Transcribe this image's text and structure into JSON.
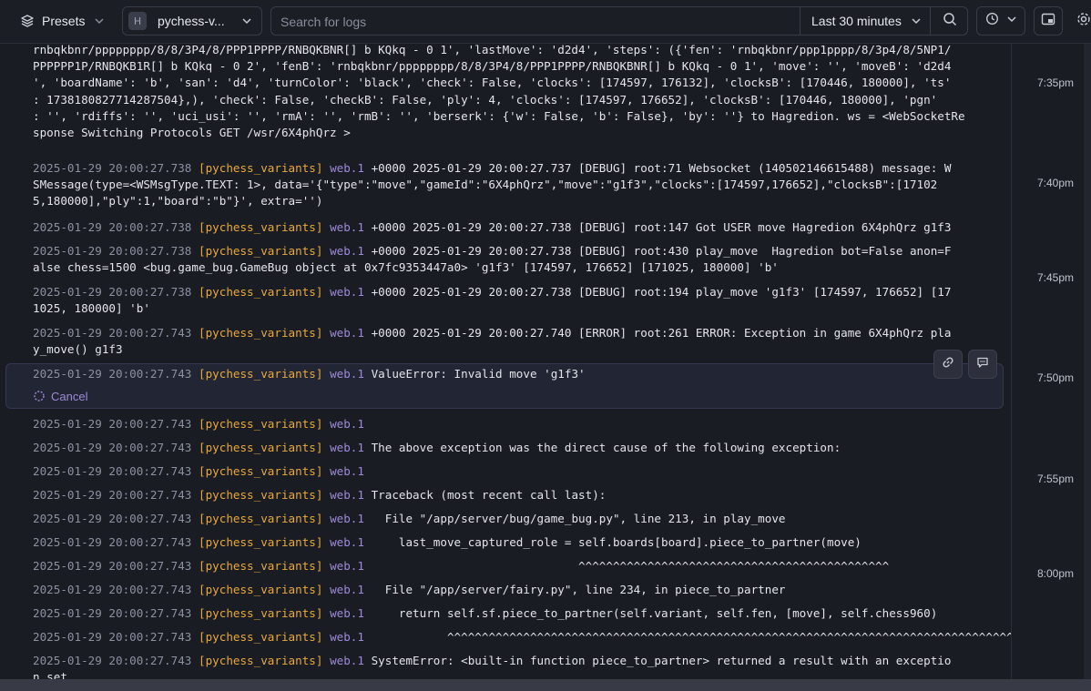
{
  "toolbar": {
    "presets_label": "Presets",
    "source_label": "pychess-v...",
    "search_placeholder": "Search for logs",
    "time_range_label": "Last 30 minutes"
  },
  "timeline": {
    "ticks": [
      "7:35pm",
      "7:40pm",
      "7:45pm",
      "7:50pm",
      "7:55pm",
      "8:00pm"
    ]
  },
  "highlight": {
    "cancel_label": "Cancel"
  },
  "log": {
    "top_lines": [
      "rnbqkbnr/pppppppp/8/8/3P4/8/PPP1PPPP/RNBQKBNR[] b KQkq - 0 1', 'lastMove': 'd2d4', 'steps': ({'fen': 'rnbqkbnr/ppp1pppp/8/3p4/8/5NP1/",
      "PPPPPP1P/RNBQKB1R[] b KQkq - 0 2', 'fenB': 'rnbqkbnr/pppppppp/8/8/3P4/8/PPP1PPPP/RNBQKBNR[] b KQkq - 0 1', 'move': '', 'moveB': 'd2d4",
      "', 'boardName': 'b', 'san': 'd4', 'turnColor': 'black', 'check': False, 'clocks': [174597, 176132], 'clocksB': [170446, 180000], 'ts'",
      ": 1738180827714287504},), 'check': False, 'checkB': False, 'ply': 4, 'clocks': [174597, 176652], 'clocksB': [170446, 180000], 'pgn'",
      ": '', 'rdiffs': '', 'uci_usi': '', 'rmA': '', 'rmB': '', 'berserk': {'w': False, 'b': False}, 'by': ''} to Hagredion. ws = <WebSocketRe",
      "sponse Switching Protocols GET /wsr/6X4phQrz >"
    ],
    "entries": [
      {
        "ts": "2025-01-29 20:00:27.738",
        "service": "[pychess_variants]",
        "pod": "web.1",
        "lines": [
          " +0000 2025-01-29 20:00:27.737 [DEBUG] root:71 Websocket (140502146615488) message: W",
          "SMessage(type=<WSMsgType.TEXT: 1>, data='{\"type\":\"move\",\"gameId\":\"6X4phQrz\",\"move\":\"g1f3\",\"clocks\":[174597,176652],\"clocksB\":[17102",
          "5,180000],\"ply\":1,\"board\":\"b\"}', extra='')"
        ]
      },
      {
        "ts": "2025-01-29 20:00:27.738",
        "service": "[pychess_variants]",
        "pod": "web.1",
        "lines": [
          " +0000 2025-01-29 20:00:27.738 [DEBUG] root:147 Got USER move Hagredion 6X4phQrz g1f3"
        ]
      },
      {
        "ts": "2025-01-29 20:00:27.738",
        "service": "[pychess_variants]",
        "pod": "web.1",
        "lines": [
          " +0000 2025-01-29 20:00:27.738 [DEBUG] root:430 play_move  Hagredion bot=False anon=F",
          "alse chess=1500 <bug.game_bug.GameBug object at 0x7fc9353447a0> 'g1f3' [174597, 176652] [171025, 180000] 'b'"
        ]
      },
      {
        "ts": "2025-01-29 20:00:27.738",
        "service": "[pychess_variants]",
        "pod": "web.1",
        "lines": [
          " +0000 2025-01-29 20:00:27.738 [DEBUG] root:194 play_move 'g1f3' [174597, 176652] [17",
          "1025, 180000] 'b'"
        ]
      },
      {
        "ts": "2025-01-29 20:00:27.743",
        "service": "[pychess_variants]",
        "pod": "web.1",
        "lines": [
          " +0000 2025-01-29 20:00:27.740 [ERROR] root:261 ERROR: Exception in game 6X4phQrz pla",
          "y_move() g1f3"
        ]
      },
      {
        "ts": "2025-01-29 20:00:27.743",
        "service": "[pychess_variants]",
        "pod": "web.1",
        "lines": [
          " ValueError: Invalid move 'g1f3'"
        ]
      },
      {
        "ts": "2025-01-29 20:00:27.743",
        "service": "[pychess_variants]",
        "pod": "web.1",
        "lines": [
          ""
        ]
      },
      {
        "ts": "2025-01-29 20:00:27.743",
        "service": "[pychess_variants]",
        "pod": "web.1",
        "lines": [
          " The above exception was the direct cause of the following exception:"
        ]
      },
      {
        "ts": "2025-01-29 20:00:27.743",
        "service": "[pychess_variants]",
        "pod": "web.1",
        "lines": [
          ""
        ]
      },
      {
        "ts": "2025-01-29 20:00:27.743",
        "service": "[pychess_variants]",
        "pod": "web.1",
        "lines": [
          " Traceback (most recent call last):"
        ]
      },
      {
        "ts": "2025-01-29 20:00:27.743",
        "service": "[pychess_variants]",
        "pod": "web.1",
        "lines": [
          "   File \"/app/server/bug/game_bug.py\", line 213, in play_move"
        ]
      },
      {
        "ts": "2025-01-29 20:00:27.743",
        "service": "[pychess_variants]",
        "pod": "web.1",
        "lines": [
          "     last_move_captured_role = self.boards[board].piece_to_partner(move)"
        ]
      },
      {
        "ts": "2025-01-29 20:00:27.743",
        "service": "[pychess_variants]",
        "pod": "web.1",
        "lines": [
          "                               ^^^^^^^^^^^^^^^^^^^^^^^^^^^^^^^^^^^^^^^^^^^^^"
        ]
      },
      {
        "ts": "2025-01-29 20:00:27.743",
        "service": "[pychess_variants]",
        "pod": "web.1",
        "lines": [
          "   File \"/app/server/fairy.py\", line 234, in piece_to_partner"
        ]
      },
      {
        "ts": "2025-01-29 20:00:27.743",
        "service": "[pychess_variants]",
        "pod": "web.1",
        "lines": [
          "     return self.sf.piece_to_partner(self.variant, self.fen, [move], self.chess960)"
        ]
      },
      {
        "ts": "2025-01-29 20:00:27.743",
        "service": "[pychess_variants]",
        "pod": "web.1",
        "lines": [
          "            ^^^^^^^^^^^^^^^^^^^^^^^^^^^^^^^^^^^^^^^^^^^^^^^^^^^^^^^^^^^^^^^^^^^^^^^^^^^^^^^^^^^^"
        ]
      },
      {
        "ts": "2025-01-29 20:00:27.743",
        "service": "[pychess_variants]",
        "pod": "web.1",
        "lines": [
          " SystemError: <built-in function piece_to_partner> returned a result with an exceptio",
          "n set"
        ]
      }
    ]
  }
}
